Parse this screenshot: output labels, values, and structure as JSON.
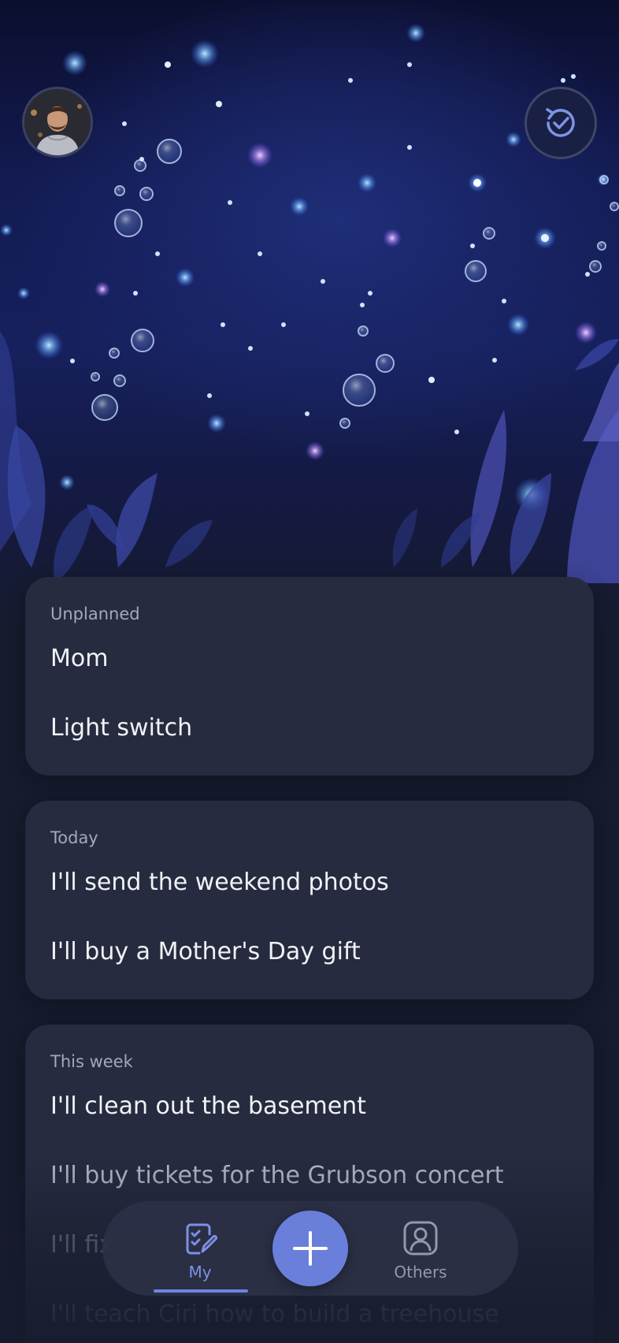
{
  "sections": {
    "unplanned": {
      "heading": "Unplanned",
      "items": [
        {
          "label": "Mom"
        },
        {
          "label": "Light switch"
        }
      ]
    },
    "today": {
      "heading": "Today",
      "items": [
        {
          "label": "I'll send the weekend photos"
        },
        {
          "label": "I'll buy a Mother's Day gift"
        }
      ]
    },
    "this_week": {
      "heading": "This week",
      "items": [
        {
          "label": "I'll clean out the basement"
        },
        {
          "label": "I'll buy tickets for the Grubson concert"
        },
        {
          "label": "I'll fix"
        },
        {
          "label": "I'll teach Ciri how to build a treehouse"
        }
      ]
    }
  },
  "nav": {
    "my_label": "My",
    "others_label": "Others",
    "my_icon": "clipboard-check-icon",
    "others_icon": "person-icon",
    "add_icon": "plus-icon",
    "active_tab": "My"
  },
  "header": {
    "avatar_icon": "user-avatar",
    "history_icon": "history-check-icon"
  },
  "colors": {
    "accent": "#6a7fd9",
    "card": "#262b3f",
    "background": "#161b2d"
  }
}
